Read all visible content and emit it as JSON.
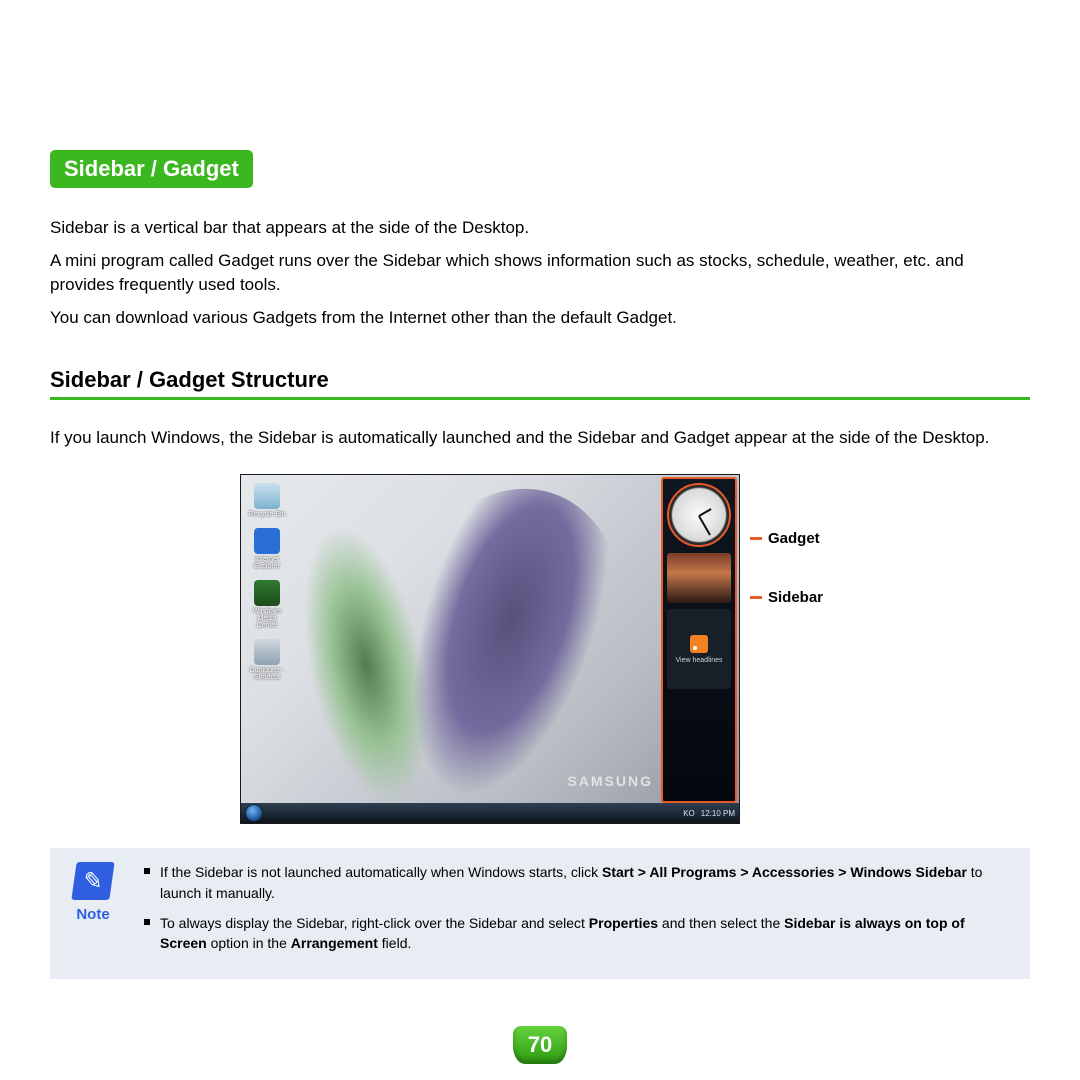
{
  "title_badge": "Sidebar / Gadget",
  "intro": {
    "p1": "Sidebar is a vertical bar that appears at the side of the Desktop.",
    "p2": "A mini program called Gadget runs over the Sidebar which shows information such as stocks, schedule, weather, etc. and provides frequently used tools.",
    "p3": "You can download various Gadgets from the Internet other than the default Gadget."
  },
  "section_heading": "Sidebar / Gadget Structure",
  "section_body": "If you launch Windows, the Sidebar is automatically launched and the Sidebar and Gadget appear at the side of the Desktop.",
  "figure": {
    "brand_text": "SAMSUNG",
    "desktop_icons": [
      {
        "name": "recycle-bin",
        "label": "Recycle Bin"
      },
      {
        "name": "internet-explorer",
        "label": "Internet Explorer"
      },
      {
        "name": "windows-media-center",
        "label": "Windows Media Center"
      },
      {
        "name": "computer-shortcut",
        "label": "Computer - Shortcut"
      }
    ],
    "gadgets": {
      "feed_text": "View headlines"
    },
    "tray": {
      "lang": "KO",
      "time": "12:10 PM"
    },
    "callouts": {
      "gadget": "Gadget",
      "sidebar": "Sidebar"
    }
  },
  "note": {
    "label": "Note",
    "items": [
      {
        "pre": "If the Sidebar is not launched automatically when Windows starts, click ",
        "bold1": "Start > All Programs > Accessories > Windows Sidebar",
        "post": " to launch it manually."
      },
      {
        "pre": "To always display the Sidebar, right-click over the Sidebar and select ",
        "bold1": "Properties",
        "mid": " and then select the ",
        "bold2": "Sidebar is always on top of Screen",
        "mid2": " option in the ",
        "bold3": "Arrangement",
        "post": " field."
      }
    ]
  },
  "page_number": "70",
  "colors": {
    "accent_green": "#3bb71f",
    "callout_orange": "#e85a2a",
    "note_bg": "#e8edf4",
    "note_blue": "#2f5fe0"
  }
}
